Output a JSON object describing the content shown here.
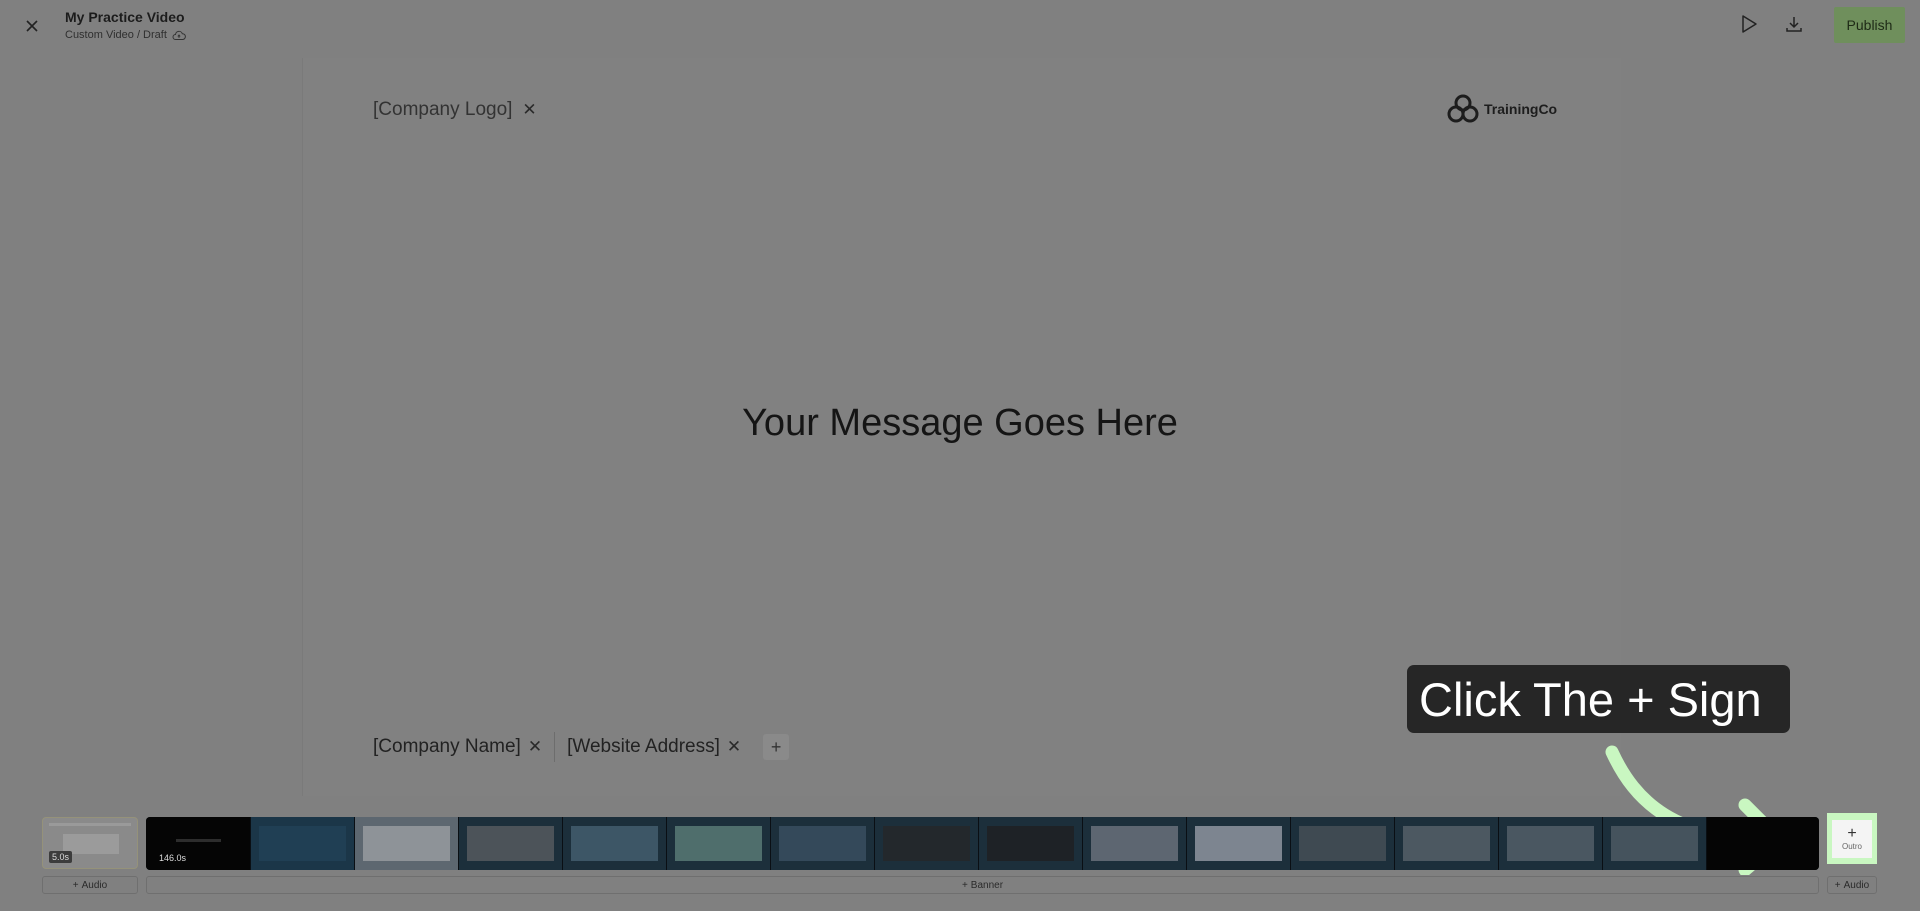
{
  "header": {
    "title": "My Practice Video",
    "subtitle": "Custom Video / Draft",
    "publish_label": "Publish"
  },
  "canvas": {
    "logo_placeholder": "[Company Logo]",
    "brand_name": "TrainingCo",
    "message": "Your Message Goes Here",
    "company_name": "[Company Name]",
    "website_address": "[Website Address]"
  },
  "tooltip": {
    "text": "Click The + Sign"
  },
  "timeline": {
    "intro_duration": "5.0s",
    "main_duration": "146.0s",
    "outro_label": "Outro",
    "audio_left_label": "Audio",
    "banner_label": "Banner",
    "audio_right_label": "Audio"
  },
  "colors": {
    "overlay_bg": "#808080",
    "publish_bg": "#6f8f5c",
    "highlight": "#c9f7c1",
    "arrow": "#c9f7c1",
    "tooltip_bg": "#262626"
  }
}
